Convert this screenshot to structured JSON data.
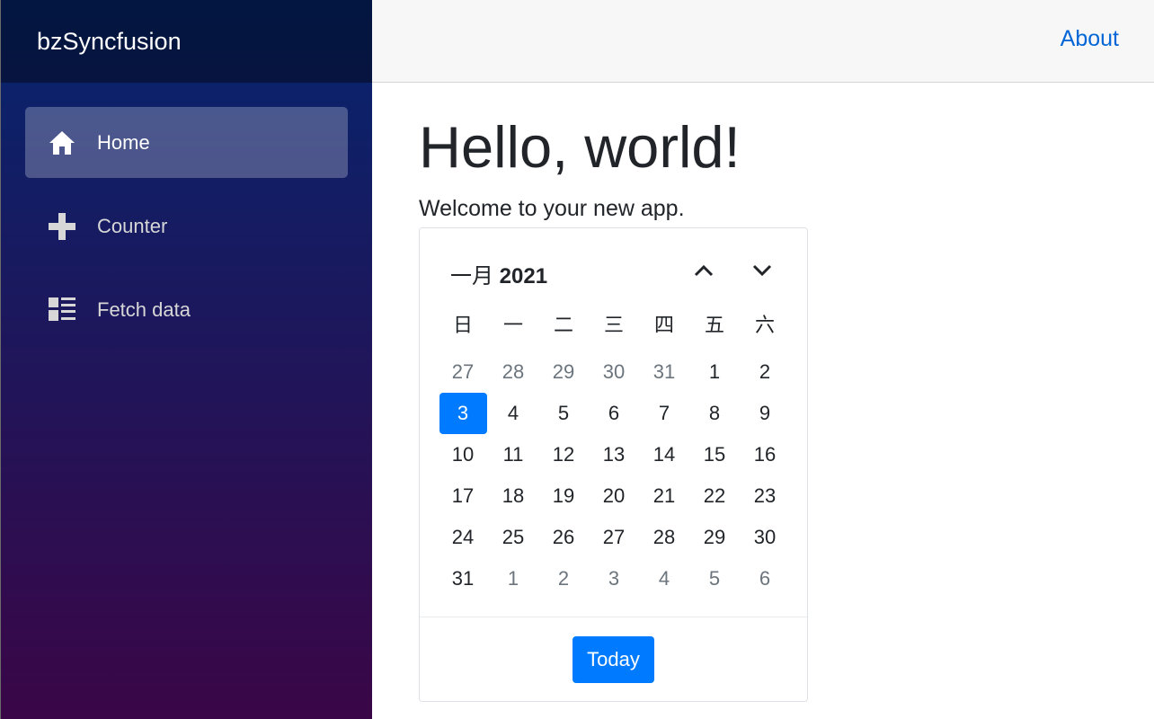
{
  "sidebar": {
    "brand": "bzSyncfusion",
    "items": [
      {
        "label": "Home",
        "icon": "home-icon",
        "active": true
      },
      {
        "label": "Counter",
        "icon": "plus-icon",
        "active": false
      },
      {
        "label": "Fetch data",
        "icon": "list-rich-icon",
        "active": false
      }
    ]
  },
  "top_row": {
    "about_label": "About"
  },
  "main": {
    "title": "Hello, world!",
    "welcome": "Welcome to your new app."
  },
  "calendar": {
    "month": "一月",
    "year": "2021",
    "weekdays": [
      "日",
      "一",
      "二",
      "三",
      "四",
      "五",
      "六"
    ],
    "weeks": [
      [
        {
          "d": "27",
          "other": true
        },
        {
          "d": "28",
          "other": true
        },
        {
          "d": "29",
          "other": true
        },
        {
          "d": "30",
          "other": true
        },
        {
          "d": "31",
          "other": true
        },
        {
          "d": "1"
        },
        {
          "d": "2"
        }
      ],
      [
        {
          "d": "3",
          "selected": true
        },
        {
          "d": "4"
        },
        {
          "d": "5"
        },
        {
          "d": "6"
        },
        {
          "d": "7"
        },
        {
          "d": "8"
        },
        {
          "d": "9"
        }
      ],
      [
        {
          "d": "10"
        },
        {
          "d": "11"
        },
        {
          "d": "12"
        },
        {
          "d": "13"
        },
        {
          "d": "14"
        },
        {
          "d": "15"
        },
        {
          "d": "16"
        }
      ],
      [
        {
          "d": "17"
        },
        {
          "d": "18"
        },
        {
          "d": "19"
        },
        {
          "d": "20"
        },
        {
          "d": "21"
        },
        {
          "d": "22"
        },
        {
          "d": "23"
        }
      ],
      [
        {
          "d": "24"
        },
        {
          "d": "25"
        },
        {
          "d": "26"
        },
        {
          "d": "27"
        },
        {
          "d": "28"
        },
        {
          "d": "29"
        },
        {
          "d": "30"
        }
      ],
      [
        {
          "d": "31"
        },
        {
          "d": "1",
          "other": true
        },
        {
          "d": "2",
          "other": true
        },
        {
          "d": "3",
          "other": true
        },
        {
          "d": "4",
          "other": true
        },
        {
          "d": "5",
          "other": true
        },
        {
          "d": "6",
          "other": true
        }
      ]
    ],
    "today_label": "Today",
    "prev_icon": "chevron-up-icon",
    "next_icon": "chevron-down-icon"
  },
  "colors": {
    "accent": "#007bff",
    "link": "#0366d6",
    "sidebar_top": "#05256e",
    "sidebar_bottom": "#3a0647"
  }
}
